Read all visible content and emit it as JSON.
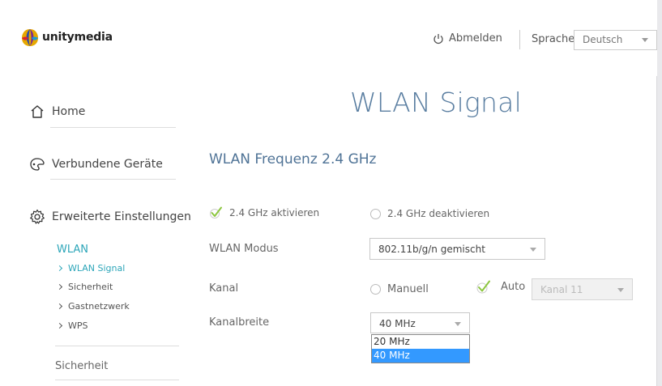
{
  "header": {
    "brand": "unitymedia",
    "logout_label": "Abmelden",
    "language_label": "Sprache",
    "language_value": "Deutsch"
  },
  "sidebar": {
    "items": [
      {
        "label": "Home",
        "icon": "home-icon"
      },
      {
        "label": "Verbundene Geräte",
        "icon": "devices-icon"
      },
      {
        "label": "Erweiterte Einstellungen",
        "icon": "gear-icon"
      }
    ],
    "submenu_title": "WLAN",
    "submenu": [
      {
        "label": "WLAN Signal",
        "active": true
      },
      {
        "label": "Sicherheit",
        "active": false
      },
      {
        "label": "Gastnetzwerk",
        "active": false
      },
      {
        "label": "WPS",
        "active": false
      }
    ],
    "footer_item": "Sicherheit"
  },
  "main": {
    "title": "WLAN Signal",
    "section_title": "WLAN Frequenz 2.4 GHz",
    "enable_option": "2.4 GHz aktivieren",
    "disable_option": "2.4 GHz deaktivieren",
    "mode_label": "WLAN Modus",
    "mode_value": "802.11b/g/n gemischt",
    "channel_label": "Kanal",
    "channel_manual": "Manuell",
    "channel_auto": "Auto",
    "channel_value": "Kanal 11",
    "bandwidth_label": "Kanalbreite",
    "bandwidth_value": "40 MHz",
    "bandwidth_options": [
      "20 MHz",
      "40 MHz"
    ]
  },
  "colors": {
    "accent": "#2da6b9",
    "title": "#5a7ea1",
    "check": "#8cc63f",
    "selection": "#3399ff"
  }
}
